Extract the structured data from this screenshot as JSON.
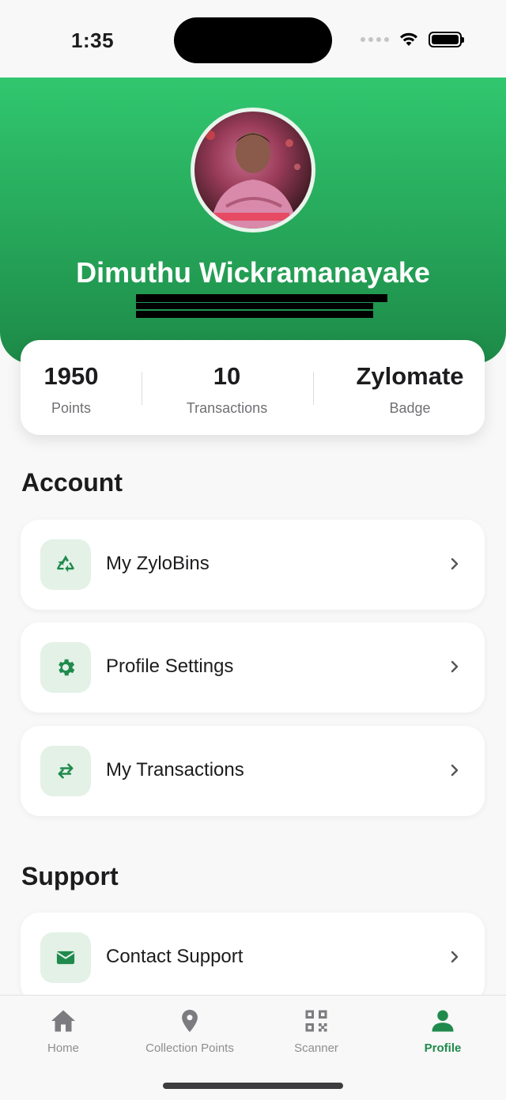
{
  "status_bar": {
    "time": "1:35"
  },
  "profile": {
    "name": "Dimuthu Wickramanayake"
  },
  "stats": [
    {
      "value": "1950",
      "label": "Points"
    },
    {
      "value": "10",
      "label": "Transactions"
    },
    {
      "value": "Zylomate",
      "label": "Badge"
    }
  ],
  "account": {
    "title": "Account",
    "items": [
      {
        "label": "My ZyloBins",
        "icon": "recycle-icon"
      },
      {
        "label": "Profile Settings",
        "icon": "gear-icon"
      },
      {
        "label": "My Transactions",
        "icon": "swap-arrows-icon"
      }
    ]
  },
  "support": {
    "title": "Support",
    "items": [
      {
        "label": "Contact Support",
        "icon": "envelope-icon"
      }
    ]
  },
  "tab_bar": {
    "tabs": [
      {
        "label": "Home",
        "icon": "home-icon",
        "active": false
      },
      {
        "label": "Collection Points",
        "icon": "map-pin-icon",
        "active": false
      },
      {
        "label": "Scanner",
        "icon": "qr-code-icon",
        "active": false
      },
      {
        "label": "Profile",
        "icon": "person-icon",
        "active": true
      }
    ]
  },
  "colors": {
    "brand_green": "#2bb866",
    "brand_dark_green": "#1f8a4c",
    "icon_bg": "#e3f1e7",
    "inactive_gray": "#8e8e93"
  }
}
